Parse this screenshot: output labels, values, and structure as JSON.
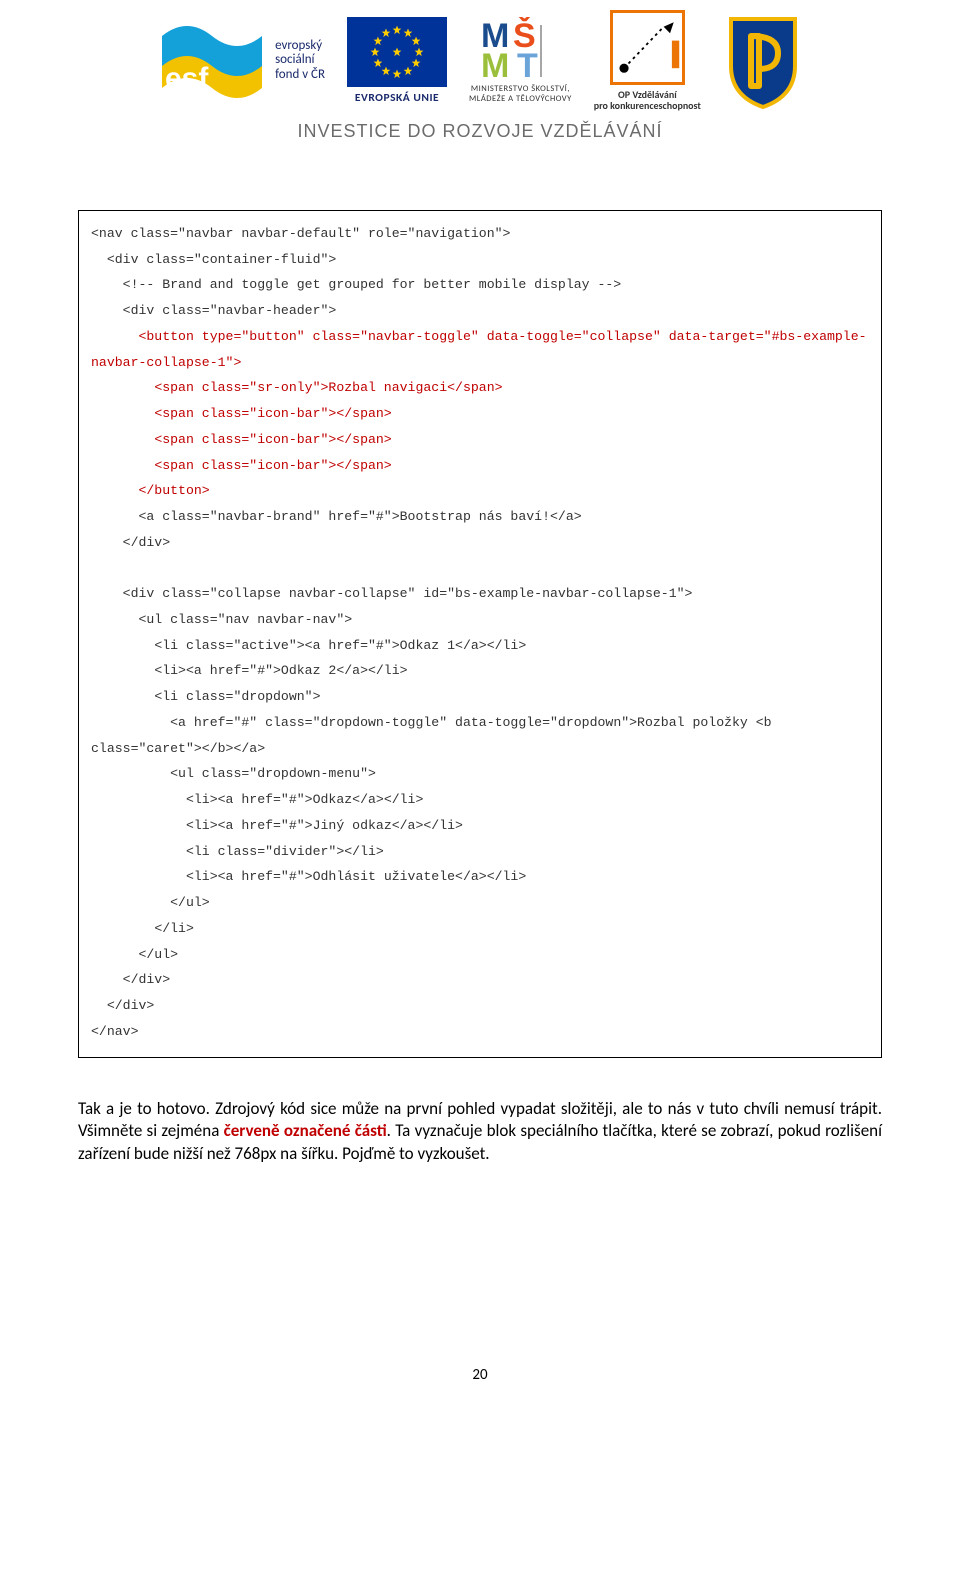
{
  "header": {
    "esf_text_line1": "evropský",
    "esf_text_line2": "sociální",
    "esf_text_line3": "fond v ČR",
    "eu_text": "EVROPSKÁ UNIE",
    "msmt_line1": "MINISTERSTVO ŠKOLSTVÍ,",
    "msmt_line2": "MLÁDEŽE A TĚLOVÝCHOVY",
    "op_line1": "OP Vzdělávání",
    "op_line2": "pro konkurenceschopnost",
    "tagline": "INVESTICE DO ROZVOJE VZDĚLÁVÁNÍ"
  },
  "code": {
    "l01": "<nav class=\"navbar navbar-default\" role=\"navigation\">",
    "l02": "  <div class=\"container-fluid\">",
    "l03": "    <!-- Brand and toggle get grouped for better mobile display -->",
    "l04": "    <div class=\"navbar-header\">",
    "l05": "      <button type=\"button\" class=\"navbar-toggle\" data-toggle=\"collapse\" data-target=\"#bs-example-navbar-collapse-1\">",
    "l06": "        <span class=\"sr-only\">Rozbal navigaci</span>",
    "l07": "        <span class=\"icon-bar\"></span>",
    "l08": "        <span class=\"icon-bar\"></span>",
    "l09": "        <span class=\"icon-bar\"></span>",
    "l10": "      </button>",
    "l11": "      <a class=\"navbar-brand\" href=\"#\">Bootstrap nás baví!</a>",
    "l12": "    </div>",
    "l13": "",
    "l14": "    <div class=\"collapse navbar-collapse\" id=\"bs-example-navbar-collapse-1\">",
    "l15": "      <ul class=\"nav navbar-nav\">",
    "l16": "        <li class=\"active\"><a href=\"#\">Odkaz 1</a></li>",
    "l17": "        <li><a href=\"#\">Odkaz 2</a></li>",
    "l18": "        <li class=\"dropdown\">",
    "l19": "          <a href=\"#\" class=\"dropdown-toggle\" data-toggle=\"dropdown\">Rozbal položky <b class=\"caret\"></b></a>",
    "l20": "          <ul class=\"dropdown-menu\">",
    "l21": "            <li><a href=\"#\">Odkaz</a></li>",
    "l22": "            <li><a href=\"#\">Jiný odkaz</a></li>",
    "l23": "            <li class=\"divider\"></li>",
    "l24": "            <li><a href=\"#\">Odhlásit uživatele</a></li>",
    "l25": "          </ul>",
    "l26": "        </li>",
    "l27": "      </ul>",
    "l28": "    </div>",
    "l29": "  </div>",
    "l30": "</nav>"
  },
  "paragraph": {
    "part1": "Tak a je to hotovo. Zdrojový kód sice může na první pohled vypadat složitěji, ale to nás v tuto chvíli nemusí trápit. Všimněte si zejména ",
    "highlight": "červeně označené části",
    "part2": ". Ta vyznačuje blok speciálního tlačítka, které se zobrazí, pokud rozlišení zařízení bude nižší než 768px na šířku. Pojďmě to vyzkoušet."
  },
  "page_number": "20"
}
